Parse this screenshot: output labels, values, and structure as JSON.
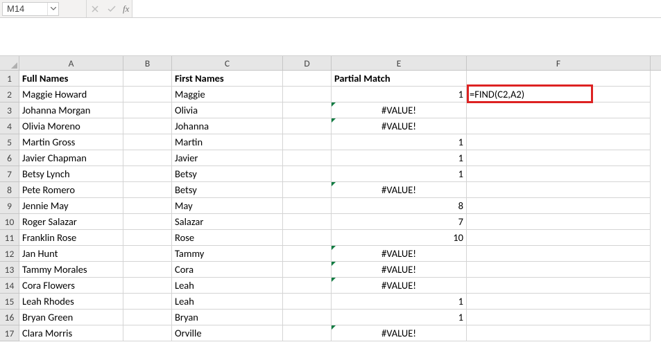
{
  "name_box": "M14",
  "formula_input": "",
  "fx_label": "fx",
  "columns": [
    "A",
    "B",
    "C",
    "D",
    "E",
    "F"
  ],
  "row_numbers": [
    "1",
    "2",
    "3",
    "4",
    "5",
    "6",
    "7",
    "8",
    "9",
    "10",
    "11",
    "12",
    "13",
    "14",
    "15",
    "16",
    "17"
  ],
  "headers": {
    "A": "Full Names",
    "C": "First Names",
    "E": "Partial Match"
  },
  "f2_text": "=FIND(C2,A2)",
  "rows": [
    {
      "A": "Maggie Howard",
      "C": "Maggie",
      "E": "1",
      "E_align": "num",
      "E_err": false
    },
    {
      "A": "Johanna Morgan",
      "C": "Olivia",
      "E": "#VALUE!",
      "E_align": "center",
      "E_err": true
    },
    {
      "A": "Olivia Moreno",
      "C": "Johanna",
      "E": "#VALUE!",
      "E_align": "center",
      "E_err": true
    },
    {
      "A": "Martin Gross",
      "C": "Martin",
      "E": "1",
      "E_align": "num",
      "E_err": false
    },
    {
      "A": "Javier Chapman",
      "C": "Javier",
      "E": "1",
      "E_align": "num",
      "E_err": false
    },
    {
      "A": "Betsy Lynch",
      "C": "Betsy",
      "E": "1",
      "E_align": "num",
      "E_err": false
    },
    {
      "A": "Pete Romero",
      "C": "Betsy",
      "E": "#VALUE!",
      "E_align": "center",
      "E_err": true
    },
    {
      "A": "Jennie May",
      "C": "May",
      "E": "8",
      "E_align": "num",
      "E_err": false
    },
    {
      "A": "Roger Salazar",
      "C": "Salazar",
      "E": "7",
      "E_align": "num",
      "E_err": false
    },
    {
      "A": "Franklin Rose",
      "C": "Rose",
      "E": "10",
      "E_align": "num",
      "E_err": false
    },
    {
      "A": "Jan Hunt",
      "C": "Tammy",
      "E": "#VALUE!",
      "E_align": "center",
      "E_err": true
    },
    {
      "A": "Tammy Morales",
      "C": "Cora",
      "E": "#VALUE!",
      "E_align": "center",
      "E_err": true
    },
    {
      "A": "Cora Flowers",
      "C": "Leah",
      "E": "#VALUE!",
      "E_align": "center",
      "E_err": true
    },
    {
      "A": "Leah Rhodes",
      "C": "Leah",
      "E": "1",
      "E_align": "num",
      "E_err": false
    },
    {
      "A": "Bryan Green",
      "C": "Bryan",
      "E": "1",
      "E_align": "num",
      "E_err": false
    },
    {
      "A": "Clara Morris",
      "C": "Orville",
      "E": "#VALUE!",
      "E_align": "center",
      "E_err": true
    }
  ],
  "colors": {
    "red_box": "#d22",
    "err_triangle": "#107c41"
  }
}
